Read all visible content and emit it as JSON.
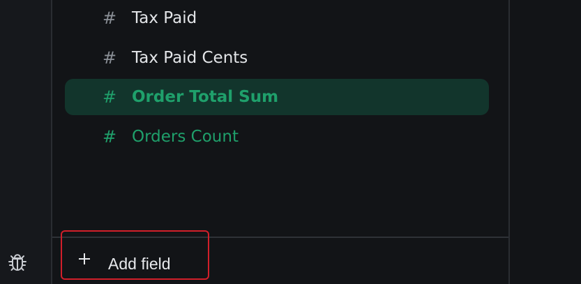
{
  "left_rail": {
    "icons": [
      {
        "name": "bug-icon"
      }
    ]
  },
  "fields": [
    {
      "hash": "#",
      "label": "Tax Paid",
      "state": "default"
    },
    {
      "hash": "#",
      "label": "Tax Paid Cents",
      "state": "default"
    },
    {
      "hash": "#",
      "label": "Order Total Sum",
      "state": "selected"
    },
    {
      "hash": "#",
      "label": "Orders Count",
      "state": "highlighted"
    }
  ],
  "actions": {
    "add_field_label": "Add field",
    "add_field_icon": "plus-icon"
  },
  "colors": {
    "background": "#121417",
    "rail_background": "#16181c",
    "text_primary": "#e3e5e8",
    "text_muted": "#8a8f96",
    "accent_green": "#1fa06b",
    "selected_background": "#12352c",
    "focus_red": "#d21f2a"
  }
}
